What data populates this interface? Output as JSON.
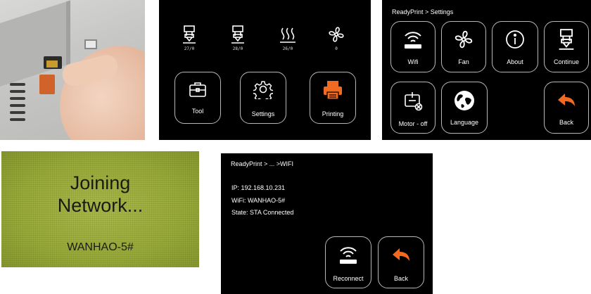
{
  "home": {
    "temps": [
      {
        "icon": "nozzle-icon",
        "value": "27/0"
      },
      {
        "icon": "nozzle-icon",
        "value": "28/0"
      },
      {
        "icon": "heatbed-icon",
        "value": "26/0"
      },
      {
        "icon": "fan-icon",
        "value": "0"
      }
    ],
    "buttons": {
      "tool": "Tool",
      "settings": "Settings",
      "printing": "Printing"
    },
    "accent": "#f26a21"
  },
  "settings": {
    "breadcrumb": "ReadyPrint > Settings",
    "buttons": {
      "wifi": "Wifi",
      "fan": "Fan",
      "about": "About",
      "continue": "Continue",
      "motor": "Motor - off",
      "language": "Language",
      "back": "Back"
    }
  },
  "lcd": {
    "line1": "Joining",
    "line2": "Network...",
    "line3": "WANHAO-5#"
  },
  "wifi": {
    "breadcrumb": "ReadyPrint > ... >WIFI",
    "ip": "IP: 192.168.10.231",
    "ssid": "WiFi: WANHAO-5#",
    "state": "State: STA  Connected",
    "buttons": {
      "reconnect": "Reconnect",
      "back": "Back"
    }
  }
}
